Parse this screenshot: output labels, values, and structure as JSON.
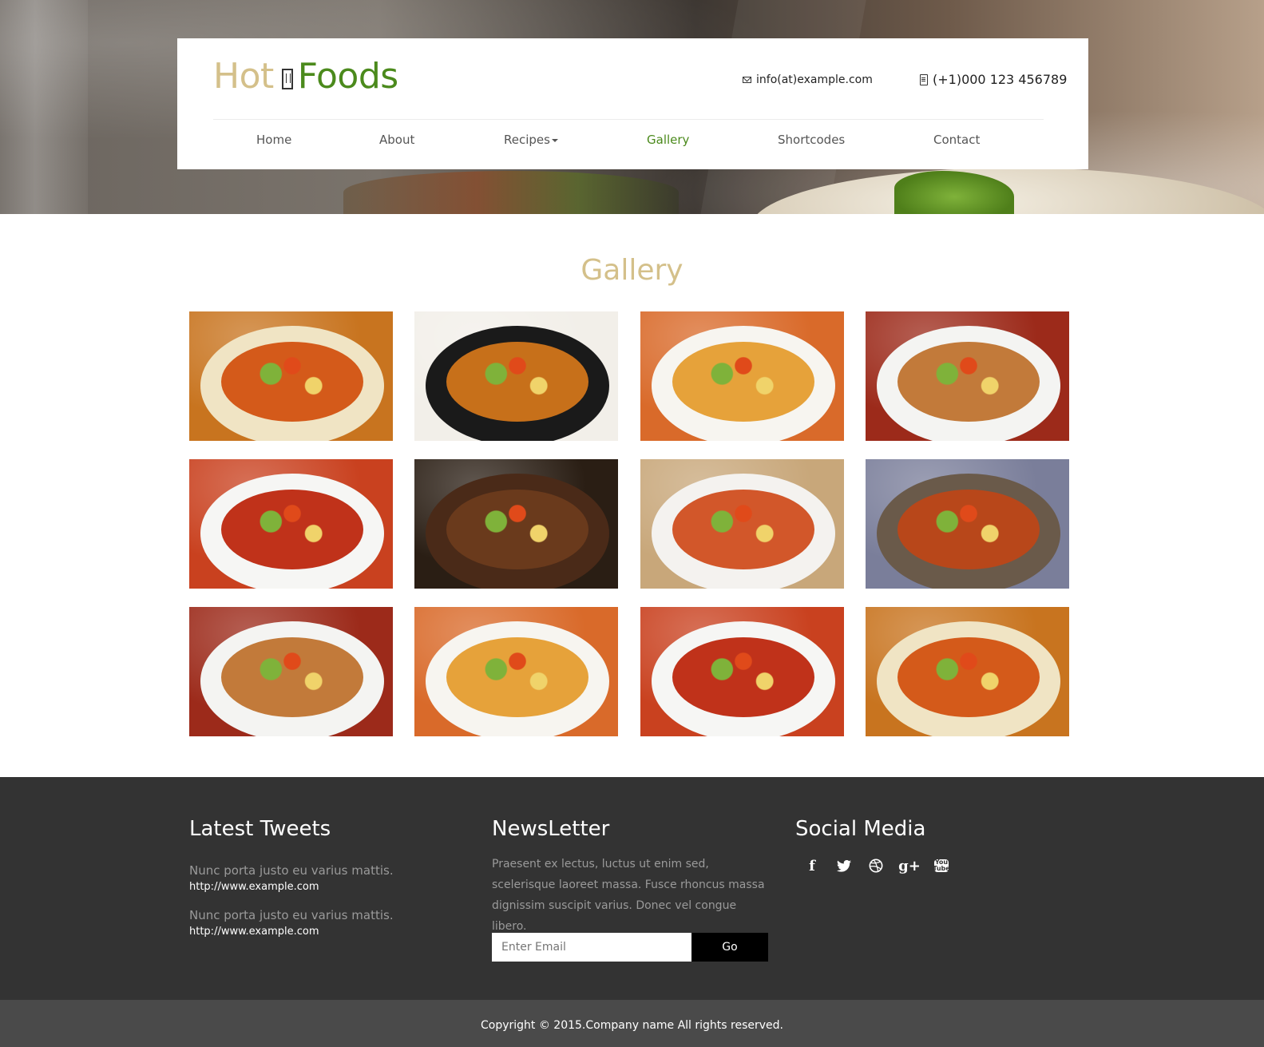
{
  "brand": {
    "word1": "Hot",
    "word2": "Foods"
  },
  "header": {
    "email": "info(at)example.com",
    "phone": "(+1)000 123 456789"
  },
  "nav": {
    "items": [
      {
        "label": "Home"
      },
      {
        "label": "About"
      },
      {
        "label": "Recipes"
      },
      {
        "label": "Gallery"
      },
      {
        "label": "Shortcodes"
      },
      {
        "label": "Contact"
      }
    ],
    "active": "Gallery"
  },
  "gallery": {
    "title": "Gallery",
    "tiles": [
      {
        "name": "soup-bowl",
        "bg": "#c8741f",
        "bowl": "#f0e4c4",
        "food": "#d45a1a"
      },
      {
        "name": "hotpot",
        "bg": "#f2efe9",
        "bowl": "#1a1a1a",
        "food": "#c7701a"
      },
      {
        "name": "noodles",
        "bg": "#d96a2a",
        "bowl": "#f7f5f0",
        "food": "#e6a23a"
      },
      {
        "name": "croissant-plate",
        "bg": "#9c2a1a",
        "bowl": "#f4f4f2",
        "food": "#c27a3a"
      },
      {
        "name": "bruschetta",
        "bg": "#c9411f",
        "bowl": "#f6f6f4",
        "food": "#c0321a"
      },
      {
        "name": "grilled-meat",
        "bg": "#2a1e14",
        "bowl": "#4a2a18",
        "food": "#6a3a1c"
      },
      {
        "name": "noodle-soup",
        "bg": "#c8a77a",
        "bowl": "#f4f2ef",
        "food": "#d2572a"
      },
      {
        "name": "fried-rice",
        "bg": "#7a7e9a",
        "bowl": "#6a5a4a",
        "food": "#b8471a"
      },
      {
        "name": "croissant-plate-2",
        "bg": "#9c2a1a",
        "bowl": "#f4f4f2",
        "food": "#c27a3a"
      },
      {
        "name": "noodles-2",
        "bg": "#d96a2a",
        "bowl": "#f7f5f0",
        "food": "#e6a23a"
      },
      {
        "name": "bruschetta-2",
        "bg": "#c9411f",
        "bowl": "#f6f6f4",
        "food": "#c0321a"
      },
      {
        "name": "soup-bowl-2",
        "bg": "#c8741f",
        "bowl": "#f0e4c4",
        "food": "#d45a1a"
      }
    ]
  },
  "footer": {
    "tweets_title": "Latest Tweets",
    "tweets": [
      {
        "text": "Nunc porta justo eu varius mattis.",
        "link": "http://www.example.com"
      },
      {
        "text": "Nunc porta justo eu varius mattis.",
        "link": "http://www.example.com"
      }
    ],
    "newsletter_title": "NewsLetter",
    "newsletter_text": "Praesent ex lectus, luctus ut enim sed, scelerisque laoreet massa. Fusce rhoncus massa dignissim suscipit varius. Donec vel congue libero.",
    "email_placeholder": "Enter Email",
    "go_label": "Go",
    "social_title": "Social Media",
    "social_icons": [
      "facebook-icon",
      "twitter-icon",
      "dribbble-icon",
      "google-plus-icon",
      "youtube-icon"
    ],
    "copyright": "Copyright © 2015.Company name All rights reserved."
  },
  "colors": {
    "accent_gold": "#d4c08a",
    "accent_green": "#4b8a1c",
    "footer_bg": "#333333",
    "copyright_bg": "#4a4a4a"
  }
}
